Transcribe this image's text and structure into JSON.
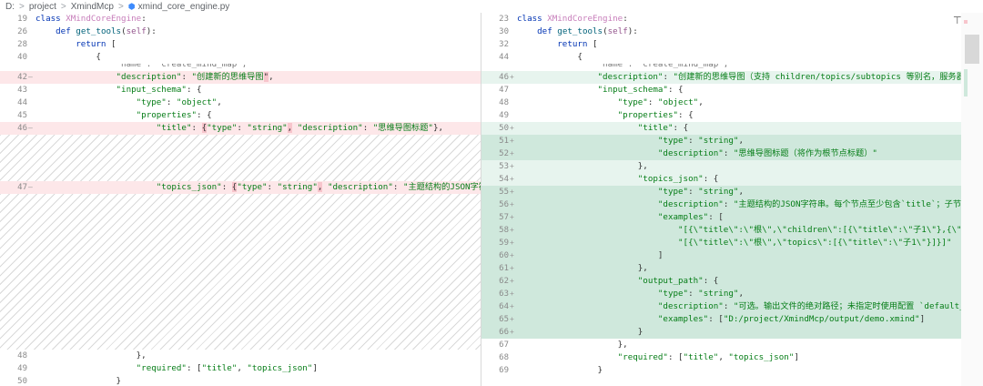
{
  "breadcrumb": {
    "items": [
      "D:",
      "project",
      "XmindMcp",
      "xmind_core_engine.py"
    ],
    "separator": ">"
  },
  "left": {
    "sticky": [
      {
        "num": "19",
        "tokens": [
          [
            "k",
            "class "
          ],
          [
            "cls",
            "XMindCoreEngine"
          ],
          [
            "p",
            ":"
          ]
        ]
      },
      {
        "num": "26",
        "tokens": [
          [
            "p",
            "    "
          ],
          [
            "k",
            "def "
          ],
          [
            "fn",
            "get_tools"
          ],
          [
            "p",
            "("
          ],
          [
            "slf",
            "self"
          ],
          [
            "p",
            "):"
          ]
        ]
      },
      {
        "num": "28",
        "tokens": [
          [
            "p",
            "        "
          ],
          [
            "k",
            "return "
          ],
          [
            "p",
            "["
          ]
        ]
      },
      {
        "num": "40",
        "tokens": [
          [
            "p",
            "            {"
          ]
        ]
      }
    ],
    "peek": "                \"name\": \"create_mind_map\",",
    "lines": [
      {
        "num": "42",
        "mark": "—",
        "kind": "del",
        "tokens": [
          [
            "p",
            "                "
          ],
          [
            "s",
            "\"description\""
          ],
          [
            "p",
            ": "
          ],
          [
            "s",
            "\"创建新的思维导图"
          ],
          [
            "hl",
            "\""
          ],
          [
            "p",
            ","
          ]
        ]
      },
      {
        "num": "43",
        "mark": "",
        "kind": "",
        "tokens": [
          [
            "p",
            "                "
          ],
          [
            "s",
            "\"input_schema\""
          ],
          [
            "p",
            ": {"
          ]
        ]
      },
      {
        "num": "44",
        "mark": "",
        "kind": "",
        "tokens": [
          [
            "p",
            "                    "
          ],
          [
            "s",
            "\"type\""
          ],
          [
            "p",
            ": "
          ],
          [
            "s",
            "\"object\""
          ],
          [
            "p",
            ","
          ]
        ]
      },
      {
        "num": "45",
        "mark": "",
        "kind": "",
        "tokens": [
          [
            "p",
            "                    "
          ],
          [
            "s",
            "\"properties\""
          ],
          [
            "p",
            ": {"
          ]
        ]
      },
      {
        "num": "46",
        "mark": "—",
        "kind": "del",
        "tokens": [
          [
            "p",
            "                        "
          ],
          [
            "s",
            "\"title\""
          ],
          [
            "p",
            ": "
          ],
          [
            "hl",
            "{"
          ],
          [
            "s",
            "\"type\""
          ],
          [
            "p",
            ": "
          ],
          [
            "s",
            "\"string\""
          ],
          [
            "hl",
            ","
          ],
          [
            "p",
            " "
          ],
          [
            "s",
            "\"description\""
          ],
          [
            "p",
            ": "
          ],
          [
            "s",
            "\"思维导图标题\""
          ],
          [
            "p",
            "},"
          ]
        ]
      },
      {
        "num": "47",
        "mark": "—",
        "kind": "del",
        "tokens": [
          [
            "p",
            "                        "
          ],
          [
            "s",
            "\"topics_json\""
          ],
          [
            "p",
            ": "
          ],
          [
            "hl",
            "{"
          ],
          [
            "s",
            "\"type\""
          ],
          [
            "p",
            ": "
          ],
          [
            "s",
            "\"string\""
          ],
          [
            "hl",
            ","
          ],
          [
            "p",
            " "
          ],
          [
            "s",
            "\"description\""
          ],
          [
            "p",
            ": "
          ],
          [
            "s",
            "\"主题结构的JSON字符串\""
          ],
          [
            "hl",
            "}"
          ]
        ]
      },
      {
        "num": "48",
        "mark": "",
        "kind": "",
        "tokens": [
          [
            "p",
            "                    },"
          ]
        ]
      },
      {
        "num": "49",
        "mark": "",
        "kind": "",
        "tokens": [
          [
            "p",
            "                    "
          ],
          [
            "s",
            "\"required\""
          ],
          [
            "p",
            ": ["
          ],
          [
            "s",
            "\"title\""
          ],
          [
            "p",
            ", "
          ],
          [
            "s",
            "\"topics_json\""
          ],
          [
            "p",
            "]"
          ]
        ]
      },
      {
        "num": "50",
        "mark": "",
        "kind": "",
        "tokens": [
          [
            "p",
            "                }"
          ]
        ]
      }
    ]
  },
  "right": {
    "sticky": [
      {
        "num": "23",
        "tokens": [
          [
            "k",
            "class "
          ],
          [
            "cls",
            "XMindCoreEngine"
          ],
          [
            "p",
            ":"
          ]
        ]
      },
      {
        "num": "30",
        "tokens": [
          [
            "p",
            "    "
          ],
          [
            "k",
            "def "
          ],
          [
            "fn",
            "get_tools"
          ],
          [
            "p",
            "("
          ],
          [
            "slf",
            "self"
          ],
          [
            "p",
            "):"
          ]
        ]
      },
      {
        "num": "32",
        "tokens": [
          [
            "p",
            "        "
          ],
          [
            "k",
            "return "
          ],
          [
            "p",
            "["
          ]
        ]
      },
      {
        "num": "44",
        "tokens": [
          [
            "p",
            "            {"
          ]
        ]
      }
    ],
    "peek": "                \"name\": \"create_mind_map\",",
    "lines": [
      {
        "num": "46",
        "mark": "+",
        "kind": "add-light",
        "tokens": [
          [
            "p",
            "                "
          ],
          [
            "s",
            "\"description\""
          ],
          [
            "p",
            ": "
          ],
          [
            "s",
            "\"创建新的思维导图（支持 children/topics/subtopics 等别名，服务器自动识别）\""
          ]
        ]
      },
      {
        "num": "47",
        "mark": "",
        "kind": "",
        "tokens": [
          [
            "p",
            "                "
          ],
          [
            "s",
            "\"input_schema\""
          ],
          [
            "p",
            ": {"
          ]
        ]
      },
      {
        "num": "48",
        "mark": "",
        "kind": "",
        "tokens": [
          [
            "p",
            "                    "
          ],
          [
            "s",
            "\"type\""
          ],
          [
            "p",
            ": "
          ],
          [
            "s",
            "\"object\""
          ],
          [
            "p",
            ","
          ]
        ]
      },
      {
        "num": "49",
        "mark": "",
        "kind": "",
        "tokens": [
          [
            "p",
            "                    "
          ],
          [
            "s",
            "\"properties\""
          ],
          [
            "p",
            ": {"
          ]
        ]
      },
      {
        "num": "50",
        "mark": "+",
        "kind": "add-light",
        "tokens": [
          [
            "p",
            "                        "
          ],
          [
            "s",
            "\"title\""
          ],
          [
            "p",
            ": {"
          ]
        ]
      },
      {
        "num": "51",
        "mark": "+",
        "kind": "add-dark",
        "tokens": [
          [
            "p",
            "                            "
          ],
          [
            "s",
            "\"type\""
          ],
          [
            "p",
            ": "
          ],
          [
            "s",
            "\"string\""
          ],
          [
            "p",
            ","
          ]
        ]
      },
      {
        "num": "52",
        "mark": "+",
        "kind": "add-dark",
        "tokens": [
          [
            "p",
            "                            "
          ],
          [
            "s",
            "\"description\""
          ],
          [
            "p",
            ": "
          ],
          [
            "s",
            "\"思维导图标题（将作为根节点标题）\""
          ]
        ]
      },
      {
        "num": "53",
        "mark": "+",
        "kind": "add-light",
        "tokens": [
          [
            "p",
            "                        },"
          ]
        ]
      },
      {
        "num": "54",
        "mark": "+",
        "kind": "add-light",
        "tokens": [
          [
            "p",
            "                        "
          ],
          [
            "s",
            "\"topics_json\""
          ],
          [
            "p",
            ": {"
          ]
        ]
      },
      {
        "num": "55",
        "mark": "+",
        "kind": "add-dark",
        "tokens": [
          [
            "p",
            "                            "
          ],
          [
            "s",
            "\"type\""
          ],
          [
            "p",
            ": "
          ],
          [
            "s",
            "\"string\""
          ],
          [
            "p",
            ","
          ]
        ]
      },
      {
        "num": "56",
        "mark": "+",
        "kind": "add-dark",
        "tokens": [
          [
            "p",
            "                            "
          ],
          [
            "s",
            "\"description\""
          ],
          [
            "p",
            ": "
          ],
          [
            "s",
            "\"主题结构的JSON字符串。每个节点至少包含`title`；子节点推荐使用`children`\""
          ]
        ]
      },
      {
        "num": "57",
        "mark": "+",
        "kind": "add-dark",
        "tokens": [
          [
            "p",
            "                            "
          ],
          [
            "s",
            "\"examples\""
          ],
          [
            "p",
            ": ["
          ]
        ]
      },
      {
        "num": "58",
        "mark": "+",
        "kind": "add-dark",
        "tokens": [
          [
            "p",
            "                                "
          ],
          [
            "s",
            "\"[{\\\"title\\\":\\\"根\\\",\\\"children\\\":[{\\\"title\\\":\\\"子1\\\"},{\\\"title\\\":\\\"子2\\\"}]}]\""
          ]
        ]
      },
      {
        "num": "59",
        "mark": "+",
        "kind": "add-dark",
        "tokens": [
          [
            "p",
            "                                "
          ],
          [
            "s",
            "\"[{\\\"title\\\":\\\"根\\\",\\\"topics\\\":[{\\\"title\\\":\\\"子1\\\"}]}]\""
          ]
        ]
      },
      {
        "num": "60",
        "mark": "+",
        "kind": "add-dark",
        "tokens": [
          [
            "p",
            "                            ]"
          ]
        ]
      },
      {
        "num": "61",
        "mark": "+",
        "kind": "add-dark",
        "tokens": [
          [
            "p",
            "                        },"
          ]
        ]
      },
      {
        "num": "62",
        "mark": "+",
        "kind": "add-dark",
        "tokens": [
          [
            "p",
            "                        "
          ],
          [
            "s",
            "\"output_path\""
          ],
          [
            "p",
            ": {"
          ]
        ]
      },
      {
        "num": "63",
        "mark": "+",
        "kind": "add-dark",
        "tokens": [
          [
            "p",
            "                            "
          ],
          [
            "s",
            "\"type\""
          ],
          [
            "p",
            ": "
          ],
          [
            "s",
            "\"string\""
          ],
          [
            "p",
            ","
          ]
        ]
      },
      {
        "num": "64",
        "mark": "+",
        "kind": "add-dark",
        "tokens": [
          [
            "p",
            "                            "
          ],
          [
            "s",
            "\"description\""
          ],
          [
            "p",
            ": "
          ],
          [
            "s",
            "\"可选。输出文件的绝对路径；未指定时使用配置 `default_output_dir`\""
          ]
        ]
      },
      {
        "num": "65",
        "mark": "+",
        "kind": "add-dark",
        "tokens": [
          [
            "p",
            "                            "
          ],
          [
            "s",
            "\"examples\""
          ],
          [
            "p",
            ": ["
          ],
          [
            "s",
            "\"D:/project/XmindMcp/output/demo.xmind\""
          ],
          [
            "p",
            "]"
          ]
        ]
      },
      {
        "num": "66",
        "mark": "+",
        "kind": "add-dark",
        "tokens": [
          [
            "p",
            "                        }"
          ]
        ]
      },
      {
        "num": "67",
        "mark": "",
        "kind": "",
        "tokens": [
          [
            "p",
            "                    },"
          ]
        ]
      },
      {
        "num": "68",
        "mark": "",
        "kind": "",
        "tokens": [
          [
            "p",
            "                    "
          ],
          [
            "s",
            "\"required\""
          ],
          [
            "p",
            ": ["
          ],
          [
            "s",
            "\"title\""
          ],
          [
            "p",
            ", "
          ],
          [
            "s",
            "\"topics_json\""
          ],
          [
            "p",
            "]"
          ]
        ]
      },
      {
        "num": "69",
        "mark": "",
        "kind": "",
        "tokens": [
          [
            "p",
            "                }"
          ]
        ]
      }
    ]
  },
  "icons": {
    "file": "python-file-icon",
    "pin": "pin-icon"
  }
}
